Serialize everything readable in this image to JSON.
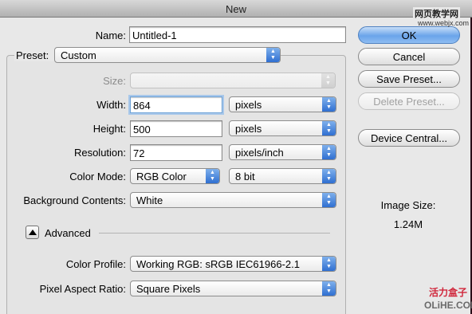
{
  "window": {
    "title": "New"
  },
  "form": {
    "name_label": "Name:",
    "name_value": "Untitled-1",
    "preset_label": "Preset:",
    "preset_value": "Custom",
    "size_label": "Size:",
    "size_value": "",
    "width_label": "Width:",
    "width_value": "864",
    "width_unit": "pixels",
    "height_label": "Height:",
    "height_value": "500",
    "height_unit": "pixels",
    "resolution_label": "Resolution:",
    "resolution_value": "72",
    "resolution_unit": "pixels/inch",
    "color_mode_label": "Color Mode:",
    "color_mode_value": "RGB Color",
    "bit_depth_value": "8 bit",
    "bg_contents_label": "Background Contents:",
    "bg_contents_value": "White",
    "advanced_label": "Advanced",
    "color_profile_label": "Color Profile:",
    "color_profile_value": "Working RGB:  sRGB IEC61966-2.1",
    "pixel_aspect_label": "Pixel Aspect Ratio:",
    "pixel_aspect_value": "Square Pixels"
  },
  "buttons": {
    "ok": "OK",
    "cancel": "Cancel",
    "save_preset": "Save Preset...",
    "delete_preset": "Delete Preset...",
    "device_central": "Device Central..."
  },
  "image_size": {
    "label": "Image Size:",
    "value": "1.24M"
  },
  "watermarks": {
    "top_right": "网页教学网",
    "top_right_url": "www.webjx.com",
    "bottom_brand": "活力盒子",
    "bottom_url": "OLiHE.COM"
  },
  "colors": {
    "accent": "#4f8fe6",
    "window_bg": "#e8e8e8",
    "focus_ring": "#a9c8ea"
  },
  "icons": {
    "popup_arrows": "updown-arrows-icon",
    "disclosure": "disclosure-triangle-icon"
  }
}
